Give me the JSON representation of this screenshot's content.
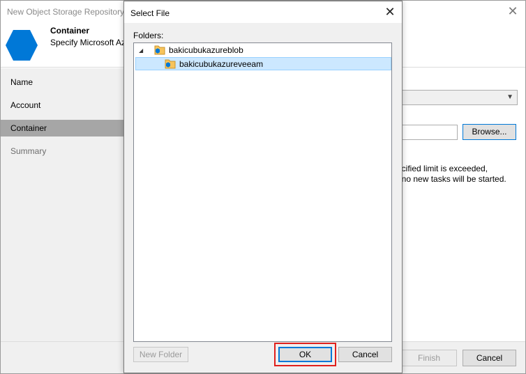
{
  "wizard": {
    "title": "New Object Storage Repository",
    "header": {
      "title": "Container",
      "subtitle": "Specify Microsoft Azure"
    },
    "nav": [
      {
        "label": "Name",
        "state": "normal"
      },
      {
        "label": "Account",
        "state": "normal"
      },
      {
        "label": "Container",
        "state": "active"
      },
      {
        "label": "Summary",
        "state": "disabled"
      }
    ],
    "browse_label": "Browse...",
    "limit_text_line1": "ecified limit is exceeded,",
    "limit_text_line2": "t no new tasks will be started.",
    "finish_label": "Finish",
    "cancel_label": "Cancel",
    "hex_color": "#0078d7"
  },
  "dialog": {
    "title": "Select File",
    "folders_label": "Folders:",
    "tree": [
      {
        "label": "bakicubukazureblob",
        "expanded": true,
        "selected": false
      },
      {
        "label": "bakicubukazureveeam",
        "expanded": false,
        "selected": true
      }
    ],
    "new_folder_label": "New Folder",
    "ok_label": "OK",
    "cancel_label": "Cancel",
    "highlight_color": "#e0201c"
  }
}
